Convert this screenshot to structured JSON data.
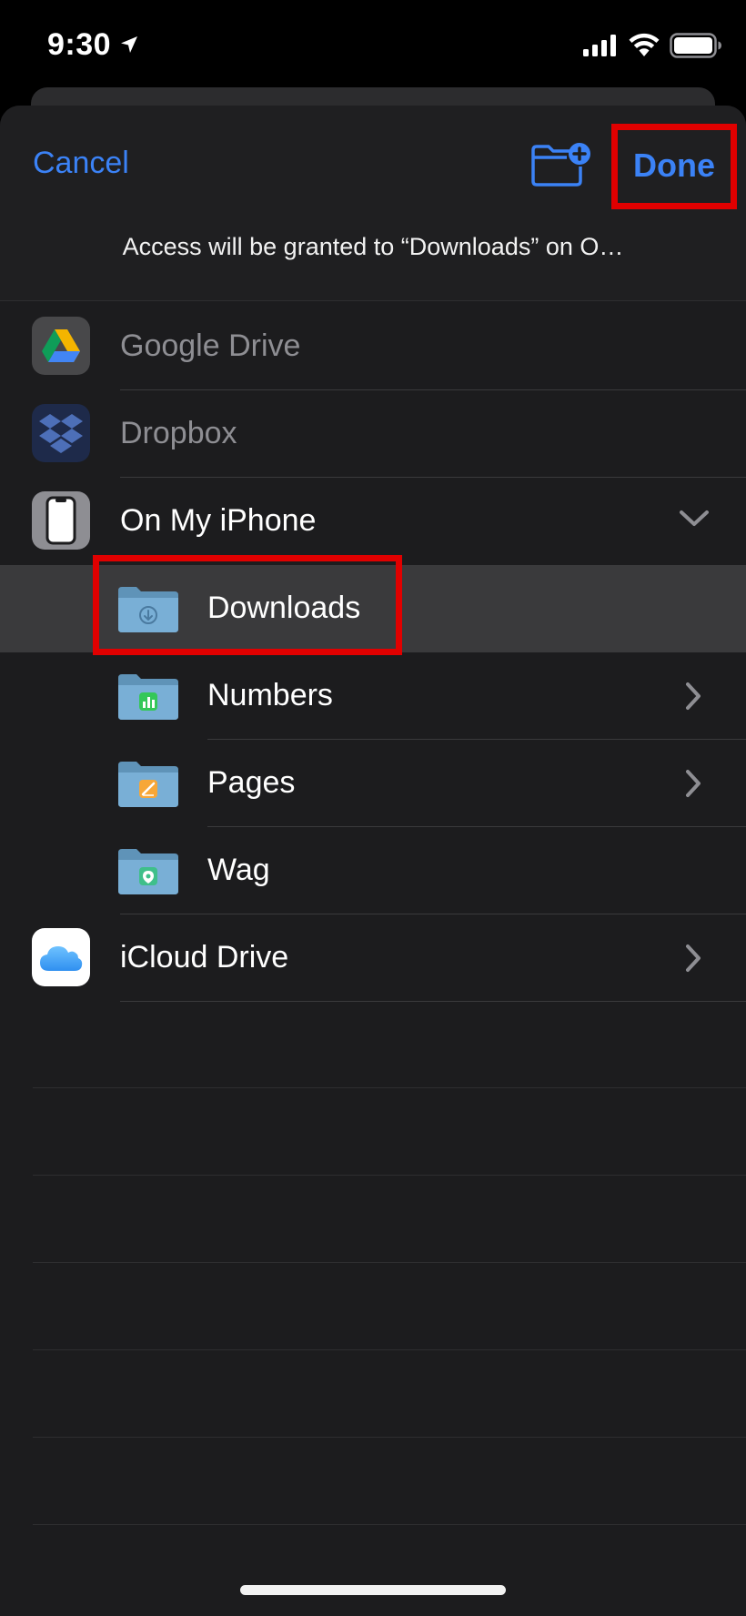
{
  "status": {
    "time": "9:30"
  },
  "nav": {
    "cancel_label": "Cancel",
    "done_label": "Done",
    "access_message": "Access will be granted to “Downloads” on O…"
  },
  "locations": [
    {
      "label": "Google Drive",
      "icon": "google-drive-icon",
      "enabled": false
    },
    {
      "label": "Dropbox",
      "icon": "dropbox-icon",
      "enabled": false
    },
    {
      "label": "On My iPhone",
      "icon": "iphone-icon",
      "expanded": true
    },
    {
      "label": "Downloads",
      "icon": "downloads-folder-icon",
      "selected": true
    },
    {
      "label": "Numbers",
      "icon": "numbers-folder-icon"
    },
    {
      "label": "Pages",
      "icon": "pages-folder-icon"
    },
    {
      "label": "Wag",
      "icon": "wag-folder-icon"
    },
    {
      "label": "iCloud Drive",
      "icon": "icloud-icon"
    }
  ],
  "colors": {
    "accent": "#3b82f6",
    "highlight": "#e00000",
    "selected_row": "#3a3a3c"
  }
}
